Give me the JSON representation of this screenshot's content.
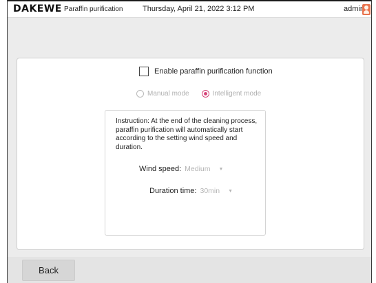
{
  "header": {
    "logo": "DAKEWE",
    "module_title": "Paraffin purification",
    "datetime": "Thursday, April 21, 2022  3:12 PM",
    "user": "admin",
    "user_icon": "user-avatar-icon"
  },
  "settings": {
    "enable_label": "Enable paraffin purification function",
    "enable_checked": false,
    "modes": [
      {
        "label": "Manual mode",
        "selected": false
      },
      {
        "label": "Intelligent mode",
        "selected": true
      }
    ],
    "accent_color": "#d6457a"
  },
  "instruction": {
    "text": "Instruction: At the end of the cleaning process, paraffin purification will automatically start according to the setting wind speed and duration.",
    "wind_speed_label": "Wind speed:",
    "wind_speed_value": "Medium",
    "duration_label": "Duration time:",
    "duration_value": "30min"
  },
  "footer": {
    "back_label": "Back"
  }
}
